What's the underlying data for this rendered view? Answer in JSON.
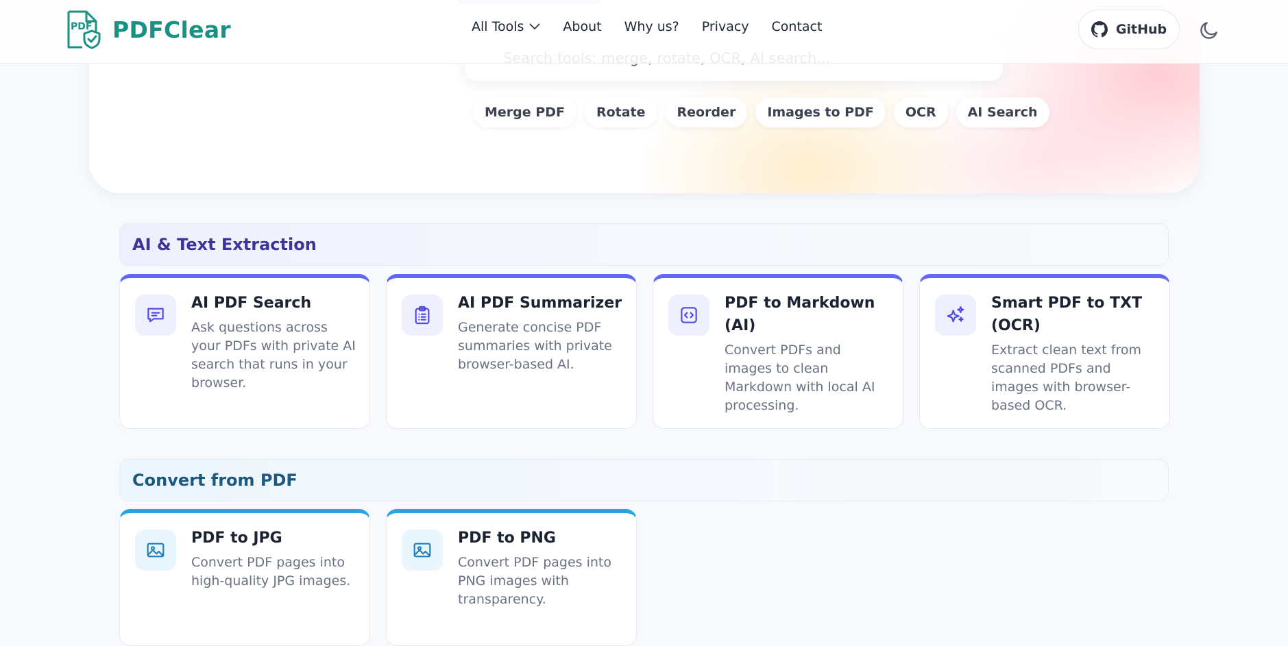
{
  "brand": {
    "name": "PDFClear",
    "logo_text": "PDF",
    "accent": "#1b9184"
  },
  "nav": [
    {
      "label": "All Tools",
      "has_dropdown": true
    },
    {
      "label": "About"
    },
    {
      "label": "Why us?"
    },
    {
      "label": "Privacy"
    },
    {
      "label": "Contact"
    }
  ],
  "github": {
    "label": "GitHub"
  },
  "search": {
    "placeholder": "Search tools: merge, rotate, OCR, AI search..."
  },
  "chips": [
    "Merge PDF",
    "Rotate",
    "Reorder",
    "Images to PDF",
    "OCR",
    "AI Search"
  ],
  "sections": [
    {
      "title": "AI & Text Extraction",
      "accent": "#6366f1",
      "tools": [
        {
          "title": "AI PDF Search",
          "desc": "Ask questions across your PDFs with private AI search that runs in your browser.",
          "icon": "chat-bubble-icon"
        },
        {
          "title": "AI PDF Summarizer",
          "desc": "Generate concise PDF summaries with private browser-based AI.",
          "icon": "clipboard-list-icon"
        },
        {
          "title": "PDF to Markdown (AI)",
          "desc": "Convert PDFs and images to clean Markdown with local AI processing.",
          "icon": "code-icon"
        },
        {
          "title": "Smart PDF to TXT (OCR)",
          "desc": "Extract clean text from scanned PDFs and images with browser-based OCR.",
          "icon": "sparkles-icon"
        }
      ]
    },
    {
      "title": "Convert from PDF",
      "accent": "#27a4e4",
      "tools": [
        {
          "title": "PDF to JPG",
          "desc": "Convert PDF pages into high-quality JPG images.",
          "icon": "image-icon"
        },
        {
          "title": "PDF to PNG",
          "desc": "Convert PDF pages into PNG images with transparency.",
          "icon": "image-icon"
        }
      ]
    }
  ]
}
